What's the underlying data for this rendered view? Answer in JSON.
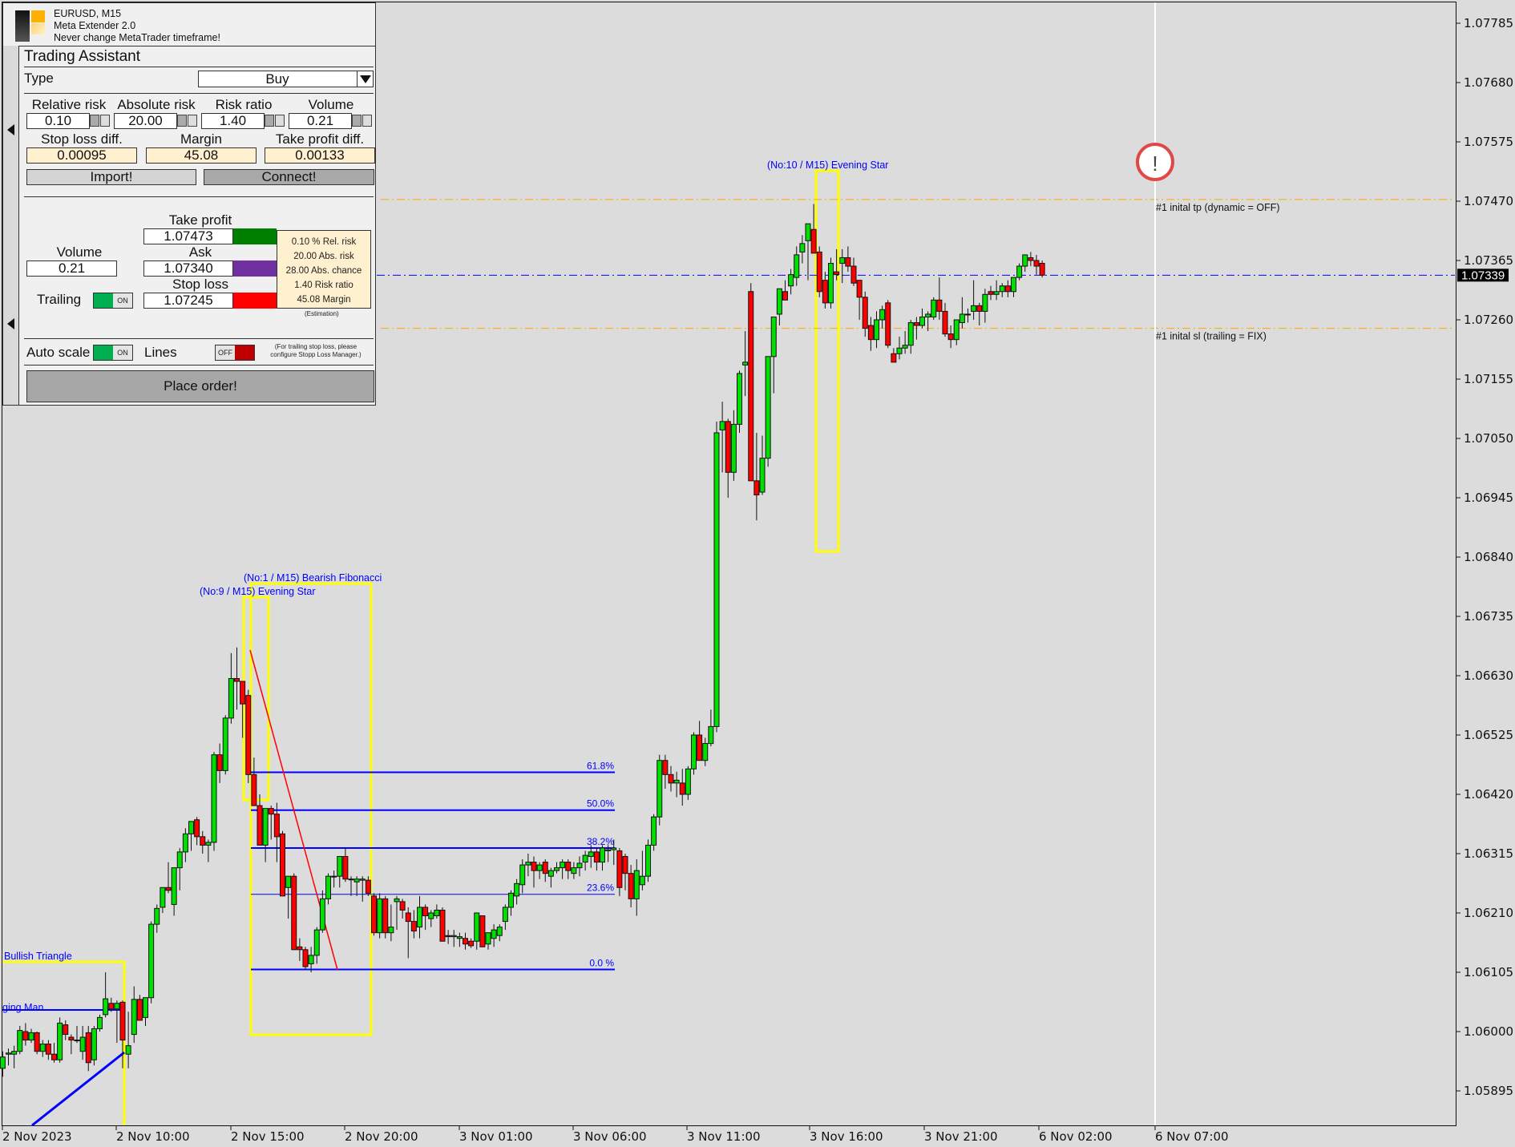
{
  "panel": {
    "header": {
      "symbol": "EURUSD, M15",
      "product": "Meta Extender 2.0",
      "warning": "Never change MetaTrader timeframe!"
    },
    "title": "Trading Assistant",
    "type_label": "Type",
    "type_value": "Buy",
    "inputs": [
      {
        "label": "Relative risk",
        "value": "0.10"
      },
      {
        "label": "Absolute risk",
        "value": "20.00"
      },
      {
        "label": "Risk ratio",
        "value": "1.40"
      },
      {
        "label": "Volume",
        "value": "0.21"
      }
    ],
    "computed": [
      {
        "label": "Stop loss diff.",
        "value": "0.00095"
      },
      {
        "label": "Margin",
        "value": "45.08"
      },
      {
        "label": "Take profit diff.",
        "value": "0.00133"
      }
    ],
    "import_button": "Import!",
    "connect_button": "Connect!",
    "volume_label": "Volume",
    "volume_value": "0.21",
    "trailing_label": "Trailing",
    "trailing_state": "ON",
    "take_profit_label": "Take profit",
    "take_profit_value": "1.07473",
    "ask_label": "Ask",
    "ask_value": "1.07340",
    "stop_loss_label": "Stop loss",
    "stop_loss_value": "1.07245",
    "summary": [
      "0.10 % Rel. risk",
      "20.00 Abs. risk",
      "28.00 Abs. chance",
      "1.40 Risk ratio",
      "45.08 Margin"
    ],
    "estimation_note": "(Estimation)",
    "auto_scale_label": "Auto scale",
    "auto_scale_state": "ON",
    "lines_label": "Lines",
    "lines_state": "OFF",
    "trailing_note_1": "(For trailing stop loss, please",
    "trailing_note_2": "configure Stopp Loss Manager.)",
    "place_order_button": "Place order!",
    "colors": {
      "take_profit": "#008000",
      "ask": "#7030a0",
      "stop_loss": "#ff0000",
      "toggle_on": "#00b050",
      "toggle_off": "#c00000"
    }
  },
  "chart": {
    "symbol": "EURUSD",
    "timeframe": "M15",
    "current_price": "1.07339",
    "price_ticks": [
      "1.07785",
      "1.07680",
      "1.07575",
      "1.07470",
      "1.07365",
      "1.07260",
      "1.07155",
      "1.07050",
      "1.06945",
      "1.06840",
      "1.06735",
      "1.06630",
      "1.06525",
      "1.06420",
      "1.06315",
      "1.06210",
      "1.06105",
      "1.06000",
      "1.05895"
    ],
    "time_ticks": [
      "2 Nov 2023",
      "2 Nov 10:00",
      "2 Nov 15:00",
      "2 Nov 20:00",
      "3 Nov 01:00",
      "3 Nov 06:00",
      "3 Nov 11:00",
      "3 Nov 16:00",
      "3 Nov 21:00",
      "6 Nov 02:00",
      "6 Nov 07:00"
    ],
    "tp_line_label": "#1 inital tp (dynamic = OFF)",
    "sl_line_label": "#1 inital sl (trailing = FIX)",
    "tp_price": 1.07473,
    "sl_price": 1.07245,
    "pattern_labels": {
      "evening_star_10": "(No:10 / M15) Evening Star",
      "evening_star_9": "(No:9 / M15) Evening Star",
      "bearish_fib": "(No:1 / M15) Bearish Fibonacci",
      "bullish_triangle": "Bullish Triangle",
      "hanging_man": "ging Man"
    },
    "fib_levels": [
      {
        "label": "61.8%",
        "price": 1.06459
      },
      {
        "label": "50.0%",
        "price": 1.06392
      },
      {
        "label": "38.2%",
        "price": 1.06325
      },
      {
        "label": "23.6%",
        "price": 1.06243
      },
      {
        "label": "0.0 %",
        "price": 1.0611
      }
    ],
    "alert_icon": "exclamation-icon",
    "colors": {
      "bull": "#00e000",
      "bear": "#ff0000",
      "tp_sl_line": "#ffa500",
      "price_line": "#0000ff",
      "pattern_box": "#ffff00",
      "fib": "#0000ff"
    },
    "candles": [
      [
        1.0599,
        1.06005,
        1.0596,
        1.05975
      ],
      [
        1.05975,
        1.05995,
        1.05955,
        1.05985
      ],
      [
        1.05985,
        1.0599,
        1.0592,
        1.0593
      ],
      [
        1.05935,
        1.05965,
        1.0592,
        1.05955
      ],
      [
        1.0596,
        1.0597,
        1.0594,
        1.05962
      ],
      [
        1.0596,
        1.05975,
        1.05935,
        1.05965
      ],
      [
        1.05965,
        1.0601,
        1.0596,
        1.06002
      ],
      [
        1.06,
        1.06015,
        1.05975,
        1.05985
      ],
      [
        1.05985,
        1.06005,
        1.0598,
        1.05998
      ],
      [
        1.05998,
        1.06,
        1.0596,
        1.05965
      ],
      [
        1.05965,
        1.05985,
        1.05955,
        1.05978
      ],
      [
        1.05978,
        1.05985,
        1.0595,
        1.0596
      ],
      [
        1.0596,
        1.0598,
        1.05945,
        1.0595
      ],
      [
        1.0595,
        1.06025,
        1.05945,
        1.06015
      ],
      [
        1.06012,
        1.0602,
        1.05985,
        1.05995
      ],
      [
        1.0599,
        1.05995,
        1.0596,
        1.05985
      ],
      [
        1.05985,
        1.0601,
        1.0598,
        1.05985
      ],
      [
        1.05965,
        1.0601,
        1.0595,
        1.0599
      ],
      [
        1.05998,
        1.0601,
        1.0593,
        1.05945
      ],
      [
        1.0595,
        1.0601,
        1.0594,
        1.06005
      ],
      [
        1.06005,
        1.0603,
        1.06,
        1.06025
      ],
      [
        1.0603,
        1.06105,
        1.06025,
        1.06058
      ],
      [
        1.0605,
        1.0606,
        1.06035,
        1.0604
      ],
      [
        1.0604,
        1.06055,
        1.0598,
        1.0605
      ],
      [
        1.06052,
        1.06055,
        1.05935,
        1.05985
      ],
      [
        1.0596,
        1.06035,
        1.05935,
        1.05975
      ],
      [
        1.05995,
        1.0608,
        1.0598,
        1.06057
      ],
      [
        1.06057,
        1.06065,
        1.06025,
        1.0602
      ],
      [
        1.06025,
        1.0606,
        1.0601,
        1.0606
      ],
      [
        1.0606,
        1.06195,
        1.0605,
        1.0619
      ],
      [
        1.0619,
        1.06225,
        1.06175,
        1.06218
      ],
      [
        1.0622,
        1.06255,
        1.0621,
        1.06255
      ],
      [
        1.06255,
        1.063,
        1.06245,
        1.0625
      ],
      [
        1.06225,
        1.06285,
        1.06205,
        1.0629
      ],
      [
        1.0629,
        1.06325,
        1.0625,
        1.06318
      ],
      [
        1.06318,
        1.0636,
        1.063,
        1.0635
      ],
      [
        1.0635,
        1.0637,
        1.0632,
        1.06372
      ],
      [
        1.06375,
        1.0638,
        1.0633,
        1.06345
      ],
      [
        1.06345,
        1.06355,
        1.06315,
        1.0633
      ],
      [
        1.0633,
        1.0634,
        1.063,
        1.06335
      ],
      [
        1.06335,
        1.06495,
        1.0632,
        1.0649
      ],
      [
        1.0649,
        1.0651,
        1.0644,
        1.06462
      ],
      [
        1.06462,
        1.0656,
        1.06455,
        1.06555
      ],
      [
        1.06555,
        1.0667,
        1.06545,
        1.06625
      ],
      [
        1.06625,
        1.0668,
        1.0657,
        1.0662
      ],
      [
        1.0662,
        1.0662,
        1.0652,
        1.0658
      ],
      [
        1.06595,
        1.06605,
        1.0644,
        1.06455
      ],
      [
        1.06455,
        1.06485,
        1.064,
        1.064
      ],
      [
        1.064,
        1.0642,
        1.0633,
        1.0633
      ],
      [
        1.0633,
        1.06395,
        1.063,
        1.06395
      ],
      [
        1.06395,
        1.064,
        1.0634,
        1.06385
      ],
      [
        1.06385,
        1.06405,
        1.063,
        1.06345
      ],
      [
        1.0635,
        1.06355,
        1.0624,
        1.0624
      ],
      [
        1.06255,
        1.06275,
        1.062,
        1.06275
      ],
      [
        1.06275,
        1.0628,
        1.06145,
        1.06145
      ],
      [
        1.0615,
        1.06165,
        1.06125,
        1.06145
      ],
      [
        1.06145,
        1.0615,
        1.0611,
        1.06115
      ],
      [
        1.0612,
        1.0615,
        1.06105,
        1.06135
      ],
      [
        1.06135,
        1.06185,
        1.0612,
        1.0618
      ],
      [
        1.0618,
        1.0625,
        1.06175,
        1.06235
      ],
      [
        1.06235,
        1.0628,
        1.06225,
        1.06275
      ],
      [
        1.06275,
        1.06285,
        1.06255,
        1.06275
      ],
      [
        1.06275,
        1.063,
        1.06255,
        1.0631
      ],
      [
        1.0631,
        1.06325,
        1.06265,
        1.0627
      ],
      [
        1.0627,
        1.06275,
        1.0624,
        1.0627
      ],
      [
        1.06265,
        1.06275,
        1.0624,
        1.0627
      ],
      [
        1.06268,
        1.06275,
        1.0623,
        1.0627
      ],
      [
        1.06268,
        1.06275,
        1.0624,
        1.06245
      ],
      [
        1.0624,
        1.06245,
        1.0617,
        1.06175
      ],
      [
        1.06175,
        1.06245,
        1.06165,
        1.06235
      ],
      [
        1.06235,
        1.0624,
        1.06165,
        1.06175
      ],
      [
        1.06175,
        1.06225,
        1.0616,
        1.06185
      ],
      [
        1.0623,
        1.0624,
        1.0618,
        1.06235
      ],
      [
        1.0623,
        1.06235,
        1.062,
        1.06215
      ],
      [
        1.0621,
        1.0622,
        1.0613,
        1.06195
      ],
      [
        1.06195,
        1.06215,
        1.06165,
        1.06178
      ],
      [
        1.06185,
        1.0624,
        1.06165,
        1.0622
      ],
      [
        1.0622,
        1.06225,
        1.0618,
        1.06205
      ],
      [
        1.062,
        1.06215,
        1.06185,
        1.0621
      ],
      [
        1.06205,
        1.06225,
        1.062,
        1.06215
      ],
      [
        1.06215,
        1.0622,
        1.06165,
        1.0616
      ],
      [
        1.0617,
        1.0618,
        1.06155,
        1.06168
      ],
      [
        1.06168,
        1.0618,
        1.0615,
        1.0617
      ],
      [
        1.06165,
        1.06175,
        1.0615,
        1.06168
      ],
      [
        1.06165,
        1.06175,
        1.06145,
        1.06155
      ],
      [
        1.0616,
        1.06165,
        1.06148,
        1.06152
      ],
      [
        1.0616,
        1.0621,
        1.06145,
        1.0621
      ],
      [
        1.06205,
        1.06205,
        1.0615,
        1.0615
      ],
      [
        1.06155,
        1.06175,
        1.06145,
        1.06175
      ],
      [
        1.06165,
        1.0619,
        1.0615,
        1.0618
      ],
      [
        1.0617,
        1.0619,
        1.0616,
        1.06185
      ],
      [
        1.06195,
        1.06225,
        1.0618,
        1.0622
      ],
      [
        1.0622,
        1.0625,
        1.06205,
        1.06245
      ],
      [
        1.0624,
        1.0627,
        1.06225,
        1.06262
      ],
      [
        1.0626,
        1.06305,
        1.06245,
        1.06295
      ],
      [
        1.06295,
        1.06315,
        1.06275,
        1.063
      ],
      [
        1.063,
        1.0631,
        1.06255,
        1.06285
      ],
      [
        1.06285,
        1.063,
        1.0627,
        1.06295
      ],
      [
        1.063,
        1.06305,
        1.06265,
        1.0628
      ],
      [
        1.06275,
        1.0629,
        1.06255,
        1.06285
      ],
      [
        1.06285,
        1.063,
        1.0628,
        1.0629
      ],
      [
        1.0629,
        1.06305,
        1.0627,
        1.063
      ],
      [
        1.063,
        1.06305,
        1.0627,
        1.06285
      ],
      [
        1.0628,
        1.063,
        1.0627,
        1.0629
      ],
      [
        1.0629,
        1.0631,
        1.06275,
        1.06298
      ],
      [
        1.063,
        1.0632,
        1.06285,
        1.06312
      ],
      [
        1.0631,
        1.0633,
        1.0629,
        1.06318
      ],
      [
        1.06318,
        1.06325,
        1.06285,
        1.063
      ],
      [
        1.063,
        1.0633,
        1.06285,
        1.06325
      ],
      [
        1.0632,
        1.0633,
        1.063,
        1.06322
      ],
      [
        1.06322,
        1.0634,
        1.06295,
        1.06325
      ],
      [
        1.0632,
        1.06325,
        1.0624,
        1.06255
      ],
      [
        1.0631,
        1.06315,
        1.0625,
        1.0628
      ],
      [
        1.0628,
        1.06295,
        1.0622,
        1.06235
      ],
      [
        1.06235,
        1.06305,
        1.06205,
        1.06285
      ],
      [
        1.0626,
        1.0632,
        1.0625,
        1.06275
      ],
      [
        1.06275,
        1.0634,
        1.06265,
        1.0633
      ],
      [
        1.0633,
        1.06385,
        1.0632,
        1.0638
      ],
      [
        1.0638,
        1.0649,
        1.06365,
        1.0648
      ],
      [
        1.0648,
        1.0649,
        1.0643,
        1.06455
      ],
      [
        1.06455,
        1.0647,
        1.06425,
        1.0644
      ],
      [
        1.0644,
        1.0646,
        1.06415,
        1.06445
      ],
      [
        1.0644,
        1.06465,
        1.064,
        1.0642
      ],
      [
        1.0642,
        1.0647,
        1.0641,
        1.06465
      ],
      [
        1.06465,
        1.0653,
        1.06455,
        1.06525
      ],
      [
        1.06525,
        1.0655,
        1.0649,
        1.0648
      ],
      [
        1.0648,
        1.0652,
        1.0647,
        1.0651
      ],
      [
        1.0651,
        1.0657,
        1.06505,
        1.0654
      ],
      [
        1.0654,
        1.0708,
        1.0653,
        1.0706
      ],
      [
        1.07065,
        1.07115,
        1.0699,
        1.0708
      ],
      [
        1.0708,
        1.07085,
        1.06945,
        1.0699
      ],
      [
        1.0699,
        1.071,
        1.06975,
        1.07075
      ],
      [
        1.07075,
        1.0717,
        1.0706,
        1.07165
      ],
      [
        1.0718,
        1.0724,
        1.07125,
        1.07185
      ],
      [
        1.0731,
        1.07325,
        1.06975,
        1.06975
      ],
      [
        1.06975,
        1.0706,
        1.06905,
        1.0695
      ],
      [
        1.06955,
        1.07055,
        1.0695,
        1.07015
      ],
      [
        1.07015,
        1.07195,
        1.07,
        1.07195
      ],
      [
        1.07195,
        1.07265,
        1.0713,
        1.07265
      ],
      [
        1.0727,
        1.0731,
        1.0725,
        1.07315
      ],
      [
        1.0731,
        1.0733,
        1.07295,
        1.07295
      ],
      [
        1.0732,
        1.0735,
        1.07305,
        1.0734
      ],
      [
        1.07335,
        1.0739,
        1.0732,
        1.07375
      ],
      [
        1.0738,
        1.0741,
        1.0736,
        1.07395
      ],
      [
        1.074,
        1.0742,
        1.0733,
        1.0743
      ],
      [
        1.0742,
        1.07465,
        1.0739,
        1.07378
      ],
      [
        1.0738,
        1.0739,
        1.073,
        1.0731
      ],
      [
        1.0733,
        1.07345,
        1.0728,
        1.0729
      ],
      [
        1.0729,
        1.0737,
        1.0728,
        1.0736
      ],
      [
        1.07345,
        1.07385,
        1.0733,
        1.0734
      ],
      [
        1.0736,
        1.07385,
        1.07325,
        1.0737
      ],
      [
        1.0737,
        1.0739,
        1.07345,
        1.07355
      ],
      [
        1.07355,
        1.0737,
        1.0732,
        1.07325
      ],
      [
        1.0733,
        1.07325,
        1.0726,
        1.073
      ],
      [
        1.073,
        1.0731,
        1.0723,
        1.07245
      ],
      [
        1.0725,
        1.07265,
        1.07205,
        1.07225
      ],
      [
        1.07225,
        1.07275,
        1.0721,
        1.0726
      ],
      [
        1.0726,
        1.07285,
        1.07245,
        1.07278
      ],
      [
        1.0729,
        1.07295,
        1.0721,
        1.07215
      ],
      [
        1.072,
        1.0721,
        1.07185,
        1.07185
      ],
      [
        1.072,
        1.0723,
        1.0719,
        1.0721
      ],
      [
        1.0721,
        1.0724,
        1.072,
        1.07215
      ],
      [
        1.07215,
        1.0726,
        1.072,
        1.07255
      ],
      [
        1.07255,
        1.07265,
        1.07225,
        1.0725
      ],
      [
        1.0725,
        1.0728,
        1.07245,
        1.07265
      ],
      [
        1.07265,
        1.07275,
        1.0724,
        1.0727
      ],
      [
        1.07265,
        1.073,
        1.0726,
        1.07295
      ],
      [
        1.07295,
        1.07335,
        1.0726,
        1.07275
      ],
      [
        1.07275,
        1.0729,
        1.0723,
        1.07235
      ],
      [
        1.07235,
        1.0725,
        1.0721,
        1.07225
      ],
      [
        1.07225,
        1.0726,
        1.07215,
        1.0726
      ],
      [
        1.07255,
        1.073,
        1.07245,
        1.0727
      ],
      [
        1.0727,
        1.0728,
        1.07255,
        1.0727
      ],
      [
        1.07275,
        1.0733,
        1.0726,
        1.07285
      ],
      [
        1.07285,
        1.0729,
        1.0725,
        1.07275
      ],
      [
        1.07275,
        1.07315,
        1.07255,
        1.07305
      ],
      [
        1.0731,
        1.0732,
        1.07295,
        1.07305
      ],
      [
        1.07305,
        1.0733,
        1.07295,
        1.0731
      ],
      [
        1.0731,
        1.07325,
        1.073,
        1.0732
      ],
      [
        1.0732,
        1.0733,
        1.073,
        1.0731
      ],
      [
        1.0731,
        1.07335,
        1.073,
        1.07335
      ],
      [
        1.07335,
        1.0736,
        1.0733,
        1.07355
      ],
      [
        1.07355,
        1.07375,
        1.07345,
        1.07375
      ],
      [
        1.0737,
        1.0738,
        1.07355,
        1.07365
      ],
      [
        1.07365,
        1.07375,
        1.0734,
        1.07355
      ],
      [
        1.0736,
        1.07365,
        1.07335,
        1.07339
      ]
    ]
  }
}
